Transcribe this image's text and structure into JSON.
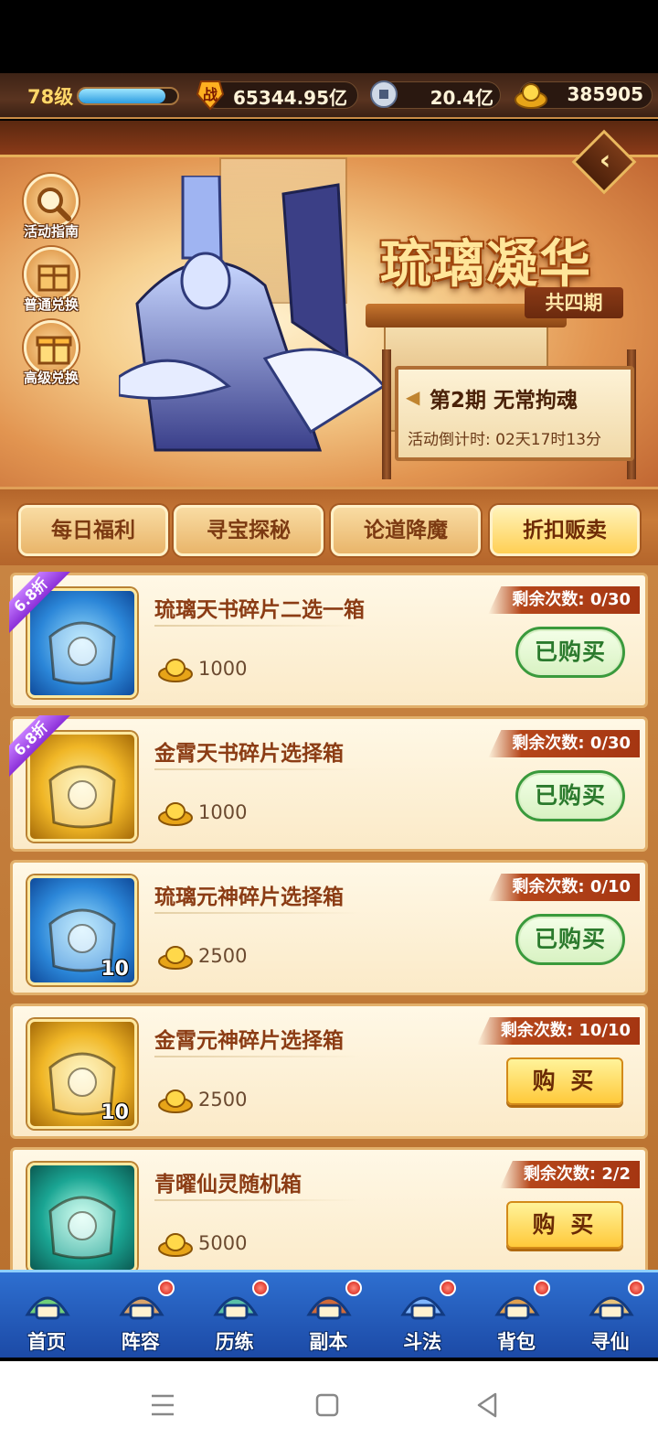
{
  "player": {
    "level": "78级",
    "xp_fraction": 0.88
  },
  "resources": {
    "power": {
      "icon": "battle-power-icon",
      "value": "65344.95亿"
    },
    "coins": {
      "icon": "copper-coin-icon",
      "value": "20.4亿"
    },
    "gold": {
      "icon": "gold-ingot-icon",
      "value": "385905"
    }
  },
  "banner": {
    "title": "琉璃凝华",
    "subtitle": "共四期",
    "period": "第2期  无常拘魂",
    "countdown": "活动倒计时: 02天17时13分",
    "side_buttons": [
      "活动指南",
      "普通兑换",
      "高级兑换"
    ]
  },
  "tabs": [
    {
      "label": "每日福利",
      "active": false
    },
    {
      "label": "寻宝探秘",
      "active": false
    },
    {
      "label": "论道降魔",
      "active": false
    },
    {
      "label": "折扣贩卖",
      "active": true
    }
  ],
  "items": [
    {
      "name": "琉璃天书碎片二选一箱",
      "price": "1000",
      "remain": "剩余次数: 0/30",
      "discount": "6.8折",
      "button": "已购买",
      "bought": true,
      "count": "",
      "frame": "blue"
    },
    {
      "name": "金霄天书碎片选择箱",
      "price": "1000",
      "remain": "剩余次数: 0/30",
      "discount": "6.8折",
      "button": "已购买",
      "bought": true,
      "count": "",
      "frame": "gold"
    },
    {
      "name": "琉璃元神碎片选择箱",
      "price": "2500",
      "remain": "剩余次数: 0/10",
      "discount": "",
      "button": "已购买",
      "bought": true,
      "count": "10",
      "frame": "blue"
    },
    {
      "name": "金霄元神碎片选择箱",
      "price": "2500",
      "remain": "剩余次数: 10/10",
      "discount": "",
      "button": "购 买",
      "bought": false,
      "count": "10",
      "frame": "gold"
    },
    {
      "name": "青曜仙灵随机箱",
      "price": "5000",
      "remain": "剩余次数: 2/2",
      "discount": "",
      "button": "购 买",
      "bought": false,
      "count": "",
      "frame": "teal"
    }
  ],
  "nav": [
    {
      "label": "首页",
      "dot": false,
      "icon": "home-icon"
    },
    {
      "label": "阵容",
      "dot": true,
      "icon": "lineup-icon"
    },
    {
      "label": "历练",
      "dot": true,
      "icon": "training-icon"
    },
    {
      "label": "副本",
      "dot": true,
      "icon": "dungeon-icon"
    },
    {
      "label": "斗法",
      "dot": true,
      "icon": "battle-icon"
    },
    {
      "label": "背包",
      "dot": true,
      "icon": "bag-icon"
    },
    {
      "label": "寻仙",
      "dot": true,
      "icon": "seek-immortal-icon"
    }
  ],
  "colors": {
    "accent": "#ffcf54",
    "bought_green": "#3a9a3c",
    "remain_red": "#a53612",
    "nav_blue": "#1c4aa6"
  }
}
